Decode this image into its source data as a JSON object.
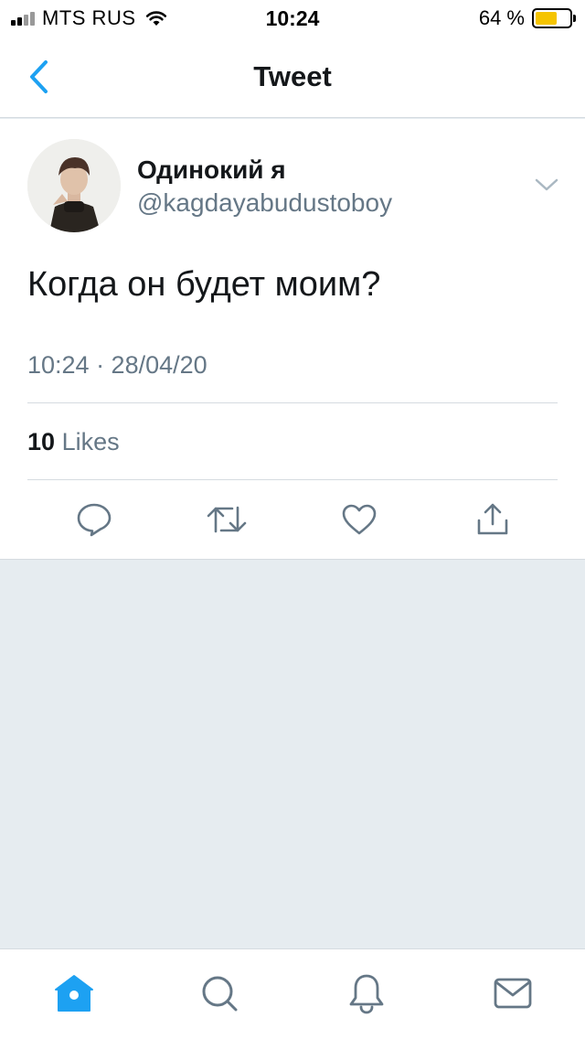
{
  "status_bar": {
    "carrier": "MTS RUS",
    "time": "10:24",
    "battery_percent": "64 %",
    "battery_level": 0.64
  },
  "nav": {
    "title": "Tweet",
    "back_icon": "chevron-left-icon"
  },
  "tweet": {
    "display_name": "Одинокий я",
    "handle": "@kagdayabudustoboy",
    "text": "Когда он будет моим?",
    "timestamp": "10:24 · 28/04/20",
    "likes_count": "10",
    "likes_label": "Likes",
    "actions": [
      "reply-icon",
      "retweet-icon",
      "like-icon",
      "share-icon"
    ]
  },
  "tab_bar": {
    "tabs": [
      "home-icon",
      "search-icon",
      "notifications-icon",
      "messages-icon"
    ],
    "active": "home-icon"
  },
  "colors": {
    "accent": "#1da1f2",
    "icon_gray": "#657786",
    "background": "#e6ecf0",
    "battery": "#f5c400"
  }
}
